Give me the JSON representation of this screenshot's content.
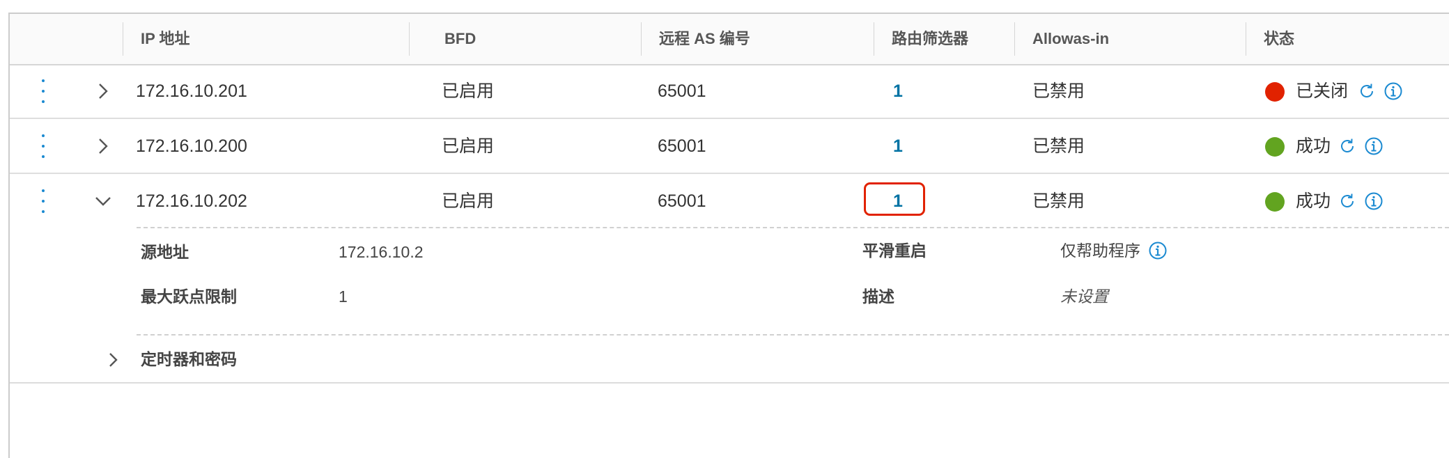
{
  "table": {
    "headers": {
      "ip": "IP 地址",
      "bfd": "BFD",
      "remote_as": "远程 AS 编号",
      "route_filter": "路由筛选器",
      "allowas_in": "Allowas-in",
      "status": "状态"
    },
    "rows": [
      {
        "ip": "172.16.10.201",
        "bfd": "已启用",
        "remote_as": "65001",
        "route_filter": "1",
        "allowas_in": "已禁用",
        "status": "已关闭",
        "status_color": "#e12200",
        "expanded": false
      },
      {
        "ip": "172.16.10.200",
        "bfd": "已启用",
        "remote_as": "65001",
        "route_filter": "1",
        "allowas_in": "已禁用",
        "status": "成功",
        "status_color": "#62a420",
        "expanded": false
      },
      {
        "ip": "172.16.10.202",
        "bfd": "已启用",
        "remote_as": "65001",
        "route_filter": "1",
        "allowas_in": "已禁用",
        "status": "成功",
        "status_color": "#62a420",
        "expanded": true
      }
    ]
  },
  "detail": {
    "source_label": "源地址",
    "source_value": "172.16.10.2",
    "max_hop_label": "最大跃点限制",
    "max_hop_value": "1",
    "graceful_restart_label": "平滑重启",
    "graceful_restart_value": "仅帮助程序",
    "description_label": "描述",
    "description_value": "未设置",
    "timers_label": "定时器和密码"
  },
  "colors": {
    "link": "#0072a3",
    "icon": "#1b8ad1",
    "status_down": "#e12200",
    "status_up": "#62a420",
    "highlight": "#e12200"
  }
}
